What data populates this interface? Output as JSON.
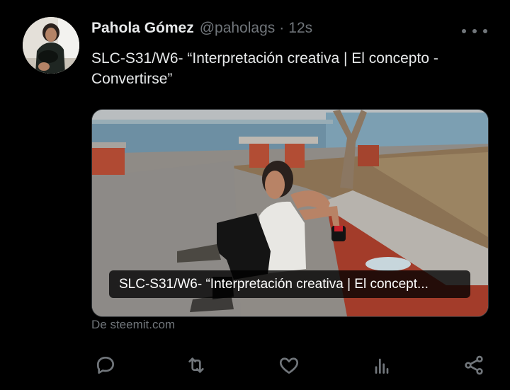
{
  "tweet": {
    "author_name": "Pahola Gómez",
    "handle": "@paholags",
    "separator": "·",
    "time": "12s",
    "text": "SLC-S31/W6- “Interpretación creativa | El concepto - Convertirse”"
  },
  "link_card": {
    "title": "SLC-S31/W6- “Interpretación creativa | El concept...",
    "source": "De steemit.com"
  },
  "actions": [
    {
      "icon": "reply-icon"
    },
    {
      "icon": "retweet-icon"
    },
    {
      "icon": "like-icon"
    },
    {
      "icon": "views-icon"
    },
    {
      "icon": "share-icon"
    }
  ],
  "colors": {
    "background": "#000000",
    "text": "#e7e9ea",
    "secondary": "#71767b"
  }
}
